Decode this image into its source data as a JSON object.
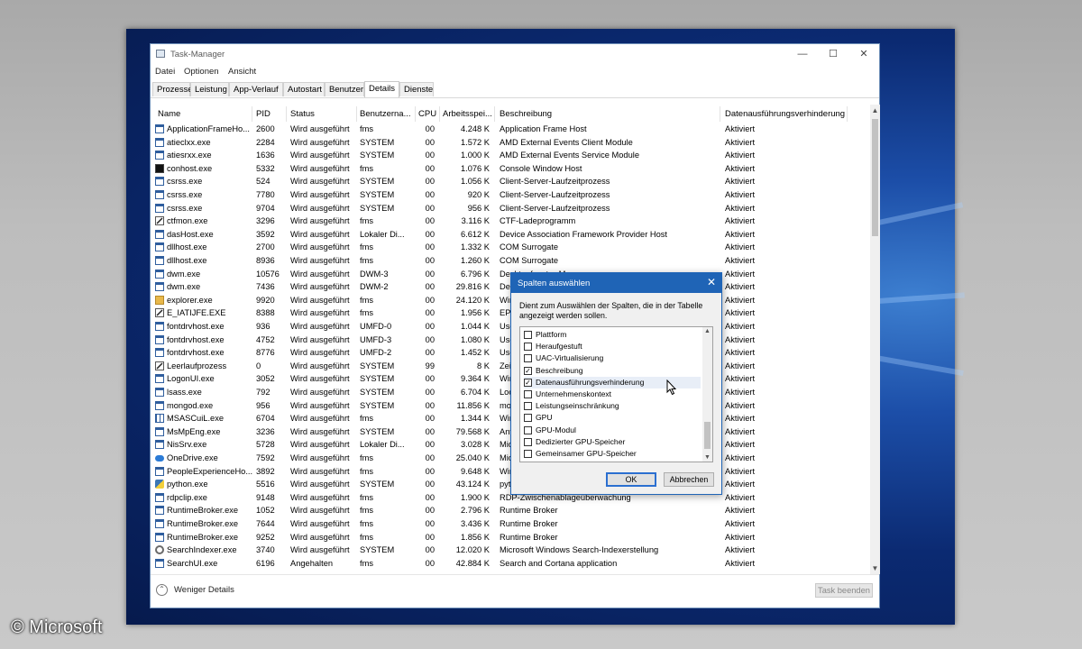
{
  "window": {
    "title": "Task-Manager"
  },
  "menu": [
    "Datei",
    "Optionen",
    "Ansicht"
  ],
  "tabs": [
    "Prozesse",
    "Leistung",
    "App-Verlauf",
    "Autostart",
    "Benutzer",
    "Details",
    "Dienste"
  ],
  "active_tab": "Details",
  "columns": [
    "Name",
    "PID",
    "Status",
    "Benutzerna...",
    "CPU",
    "Arbeitsspei...",
    "Beschreibung",
    "Datenausführungsverhinderung"
  ],
  "rows": [
    {
      "icon": "window-icon",
      "name": "ApplicationFrameHo...",
      "pid": "2600",
      "status": "Wird ausgeführt",
      "user": "fms",
      "cpu": "00",
      "mem": "4.248 K",
      "desc": "Application Frame Host",
      "dep": "Aktiviert"
    },
    {
      "icon": "window-icon",
      "name": "atieclxx.exe",
      "pid": "2284",
      "status": "Wird ausgeführt",
      "user": "SYSTEM",
      "cpu": "00",
      "mem": "1.572 K",
      "desc": "AMD External Events Client Module",
      "dep": "Aktiviert"
    },
    {
      "icon": "window-icon",
      "name": "atiesrxx.exe",
      "pid": "1636",
      "status": "Wird ausgeführt",
      "user": "SYSTEM",
      "cpu": "00",
      "mem": "1.000 K",
      "desc": "AMD External Events Service Module",
      "dep": "Aktiviert"
    },
    {
      "icon": "console-icon",
      "name": "conhost.exe",
      "pid": "5332",
      "status": "Wird ausgeführt",
      "user": "fms",
      "cpu": "00",
      "mem": "1.076 K",
      "desc": "Console Window Host",
      "dep": "Aktiviert"
    },
    {
      "icon": "window-icon",
      "name": "csrss.exe",
      "pid": "524",
      "status": "Wird ausgeführt",
      "user": "SYSTEM",
      "cpu": "00",
      "mem": "1.056 K",
      "desc": "Client-Server-Laufzeitprozess",
      "dep": "Aktiviert"
    },
    {
      "icon": "window-icon",
      "name": "csrss.exe",
      "pid": "7780",
      "status": "Wird ausgeführt",
      "user": "SYSTEM",
      "cpu": "00",
      "mem": "920 K",
      "desc": "Client-Server-Laufzeitprozess",
      "dep": "Aktiviert"
    },
    {
      "icon": "window-icon",
      "name": "csrss.exe",
      "pid": "9704",
      "status": "Wird ausgeführt",
      "user": "SYSTEM",
      "cpu": "00",
      "mem": "956 K",
      "desc": "Client-Server-Laufzeitprozess",
      "dep": "Aktiviert"
    },
    {
      "icon": "pen-icon",
      "name": "ctfmon.exe",
      "pid": "3296",
      "status": "Wird ausgeführt",
      "user": "fms",
      "cpu": "00",
      "mem": "3.116 K",
      "desc": "CTF-Ladeprogramm",
      "dep": "Aktiviert"
    },
    {
      "icon": "window-icon",
      "name": "dasHost.exe",
      "pid": "3592",
      "status": "Wird ausgeführt",
      "user": "Lokaler Di...",
      "cpu": "00",
      "mem": "6.612 K",
      "desc": "Device Association Framework Provider Host",
      "dep": "Aktiviert"
    },
    {
      "icon": "window-icon",
      "name": "dllhost.exe",
      "pid": "2700",
      "status": "Wird ausgeführt",
      "user": "fms",
      "cpu": "00",
      "mem": "1.332 K",
      "desc": "COM Surrogate",
      "dep": "Aktiviert"
    },
    {
      "icon": "window-icon",
      "name": "dllhost.exe",
      "pid": "8936",
      "status": "Wird ausgeführt",
      "user": "fms",
      "cpu": "00",
      "mem": "1.260 K",
      "desc": "COM Surrogate",
      "dep": "Aktiviert"
    },
    {
      "icon": "window-icon",
      "name": "dwm.exe",
      "pid": "10576",
      "status": "Wird ausgeführt",
      "user": "DWM-3",
      "cpu": "00",
      "mem": "6.796 K",
      "desc": "Desktopfenster-M...",
      "dep": "Aktiviert"
    },
    {
      "icon": "window-icon",
      "name": "dwm.exe",
      "pid": "7436",
      "status": "Wird ausgeführt",
      "user": "DWM-2",
      "cpu": "00",
      "mem": "29.816 K",
      "desc": "Des",
      "dep": "Aktiviert"
    },
    {
      "icon": "folder-icon",
      "name": "explorer.exe",
      "pid": "9920",
      "status": "Wird ausgeführt",
      "user": "fms",
      "cpu": "00",
      "mem": "24.120 K",
      "desc": "Wir",
      "dep": "Aktiviert"
    },
    {
      "icon": "pen-icon",
      "name": "E_IATIJFE.EXE",
      "pid": "8388",
      "status": "Wird ausgeführt",
      "user": "fms",
      "cpu": "00",
      "mem": "1.956 K",
      "desc": "EPS",
      "dep": "Aktiviert"
    },
    {
      "icon": "window-icon",
      "name": "fontdrvhost.exe",
      "pid": "936",
      "status": "Wird ausgeführt",
      "user": "UMFD-0",
      "cpu": "00",
      "mem": "1.044 K",
      "desc": "Use",
      "dep": "Aktiviert"
    },
    {
      "icon": "window-icon",
      "name": "fontdrvhost.exe",
      "pid": "4752",
      "status": "Wird ausgeführt",
      "user": "UMFD-3",
      "cpu": "00",
      "mem": "1.080 K",
      "desc": "Use",
      "dep": "Aktiviert"
    },
    {
      "icon": "window-icon",
      "name": "fontdrvhost.exe",
      "pid": "8776",
      "status": "Wird ausgeführt",
      "user": "UMFD-2",
      "cpu": "00",
      "mem": "1.452 K",
      "desc": "Use",
      "dep": "Aktiviert"
    },
    {
      "icon": "pen-icon",
      "name": "Leerlaufprozess",
      "pid": "0",
      "status": "Wird ausgeführt",
      "user": "SYSTEM",
      "cpu": "99",
      "mem": "8 K",
      "desc": "Zei",
      "dep": "Aktiviert"
    },
    {
      "icon": "window-icon",
      "name": "LogonUI.exe",
      "pid": "3052",
      "status": "Wird ausgeführt",
      "user": "SYSTEM",
      "cpu": "00",
      "mem": "9.364 K",
      "desc": "Win",
      "dep": "Aktiviert"
    },
    {
      "icon": "window-icon",
      "name": "lsass.exe",
      "pid": "792",
      "status": "Wird ausgeführt",
      "user": "SYSTEM",
      "cpu": "00",
      "mem": "6.704 K",
      "desc": "Loc",
      "dep": "Aktiviert"
    },
    {
      "icon": "window-icon",
      "name": "mongod.exe",
      "pid": "956",
      "status": "Wird ausgeführt",
      "user": "SYSTEM",
      "cpu": "00",
      "mem": "11.856 K",
      "desc": "mo",
      "dep": "Aktiviert"
    },
    {
      "icon": "grid-icon",
      "name": "MSASCuiL.exe",
      "pid": "6704",
      "status": "Wird ausgeführt",
      "user": "fms",
      "cpu": "00",
      "mem": "1.344 K",
      "desc": "Win",
      "dep": "Aktiviert"
    },
    {
      "icon": "window-icon",
      "name": "MsMpEng.exe",
      "pid": "3236",
      "status": "Wird ausgeführt",
      "user": "SYSTEM",
      "cpu": "00",
      "mem": "79.568 K",
      "desc": "Ant",
      "dep": "Aktiviert"
    },
    {
      "icon": "window-icon",
      "name": "NisSrv.exe",
      "pid": "5728",
      "status": "Wird ausgeführt",
      "user": "Lokaler Di...",
      "cpu": "00",
      "mem": "3.028 K",
      "desc": "Mic",
      "dep": "Aktiviert"
    },
    {
      "icon": "cloud-icon",
      "name": "OneDrive.exe",
      "pid": "7592",
      "status": "Wird ausgeführt",
      "user": "fms",
      "cpu": "00",
      "mem": "25.040 K",
      "desc": "Mic",
      "dep": "Aktiviert"
    },
    {
      "icon": "window-icon",
      "name": "PeopleExperienceHo...",
      "pid": "3892",
      "status": "Wird ausgeführt",
      "user": "fms",
      "cpu": "00",
      "mem": "9.648 K",
      "desc": "Win",
      "dep": "Aktiviert"
    },
    {
      "icon": "python-icon",
      "name": "python.exe",
      "pid": "5516",
      "status": "Wird ausgeführt",
      "user": "SYSTEM",
      "cpu": "00",
      "mem": "43.124 K",
      "desc": "pyt",
      "dep": "Aktiviert"
    },
    {
      "icon": "window-icon",
      "name": "rdpclip.exe",
      "pid": "9148",
      "status": "Wird ausgeführt",
      "user": "fms",
      "cpu": "00",
      "mem": "1.900 K",
      "desc": "RDP-Zwischenablageüberwachung",
      "dep": "Aktiviert"
    },
    {
      "icon": "window-icon",
      "name": "RuntimeBroker.exe",
      "pid": "1052",
      "status": "Wird ausgeführt",
      "user": "fms",
      "cpu": "00",
      "mem": "2.796 K",
      "desc": "Runtime Broker",
      "dep": "Aktiviert"
    },
    {
      "icon": "window-icon",
      "name": "RuntimeBroker.exe",
      "pid": "7644",
      "status": "Wird ausgeführt",
      "user": "fms",
      "cpu": "00",
      "mem": "3.436 K",
      "desc": "Runtime Broker",
      "dep": "Aktiviert"
    },
    {
      "icon": "window-icon",
      "name": "RuntimeBroker.exe",
      "pid": "9252",
      "status": "Wird ausgeführt",
      "user": "fms",
      "cpu": "00",
      "mem": "1.856 K",
      "desc": "Runtime Broker",
      "dep": "Aktiviert"
    },
    {
      "icon": "search-icon",
      "name": "SearchIndexer.exe",
      "pid": "3740",
      "status": "Wird ausgeführt",
      "user": "SYSTEM",
      "cpu": "00",
      "mem": "12.020 K",
      "desc": "Microsoft Windows Search-Indexerstellung",
      "dep": "Aktiviert"
    },
    {
      "icon": "window-icon",
      "name": "SearchUI.exe",
      "pid": "6196",
      "status": "Angehalten",
      "user": "fms",
      "cpu": "00",
      "mem": "42.884 K",
      "desc": "Search and Cortana application",
      "dep": "Aktiviert"
    }
  ],
  "footer": {
    "fewer_details": "Weniger Details",
    "end_task": "Task beenden"
  },
  "dialog": {
    "title": "Spalten auswählen",
    "description": "Dient zum Auswählen der Spalten, die in der Tabelle angezeigt werden sollen.",
    "options": [
      {
        "label": "Plattform",
        "checked": false
      },
      {
        "label": "Heraufgestuft",
        "checked": false
      },
      {
        "label": "UAC-Virtualisierung",
        "checked": false
      },
      {
        "label": "Beschreibung",
        "checked": true
      },
      {
        "label": "Datenausführungsverhinderung",
        "checked": true
      },
      {
        "label": "Unternehmenskontext",
        "checked": false
      },
      {
        "label": "Leistungseinschränkung",
        "checked": false
      },
      {
        "label": "GPU",
        "checked": false
      },
      {
        "label": "GPU-Modul",
        "checked": false
      },
      {
        "label": "Dedizierter GPU-Speicher",
        "checked": false
      },
      {
        "label": "Gemeinsamer GPU-Speicher",
        "checked": false
      }
    ],
    "ok": "OK",
    "cancel": "Abbrechen"
  },
  "copyright": "© Microsoft",
  "colors": {
    "accent": "#1f64b6",
    "desktop": "#0b2a72"
  }
}
